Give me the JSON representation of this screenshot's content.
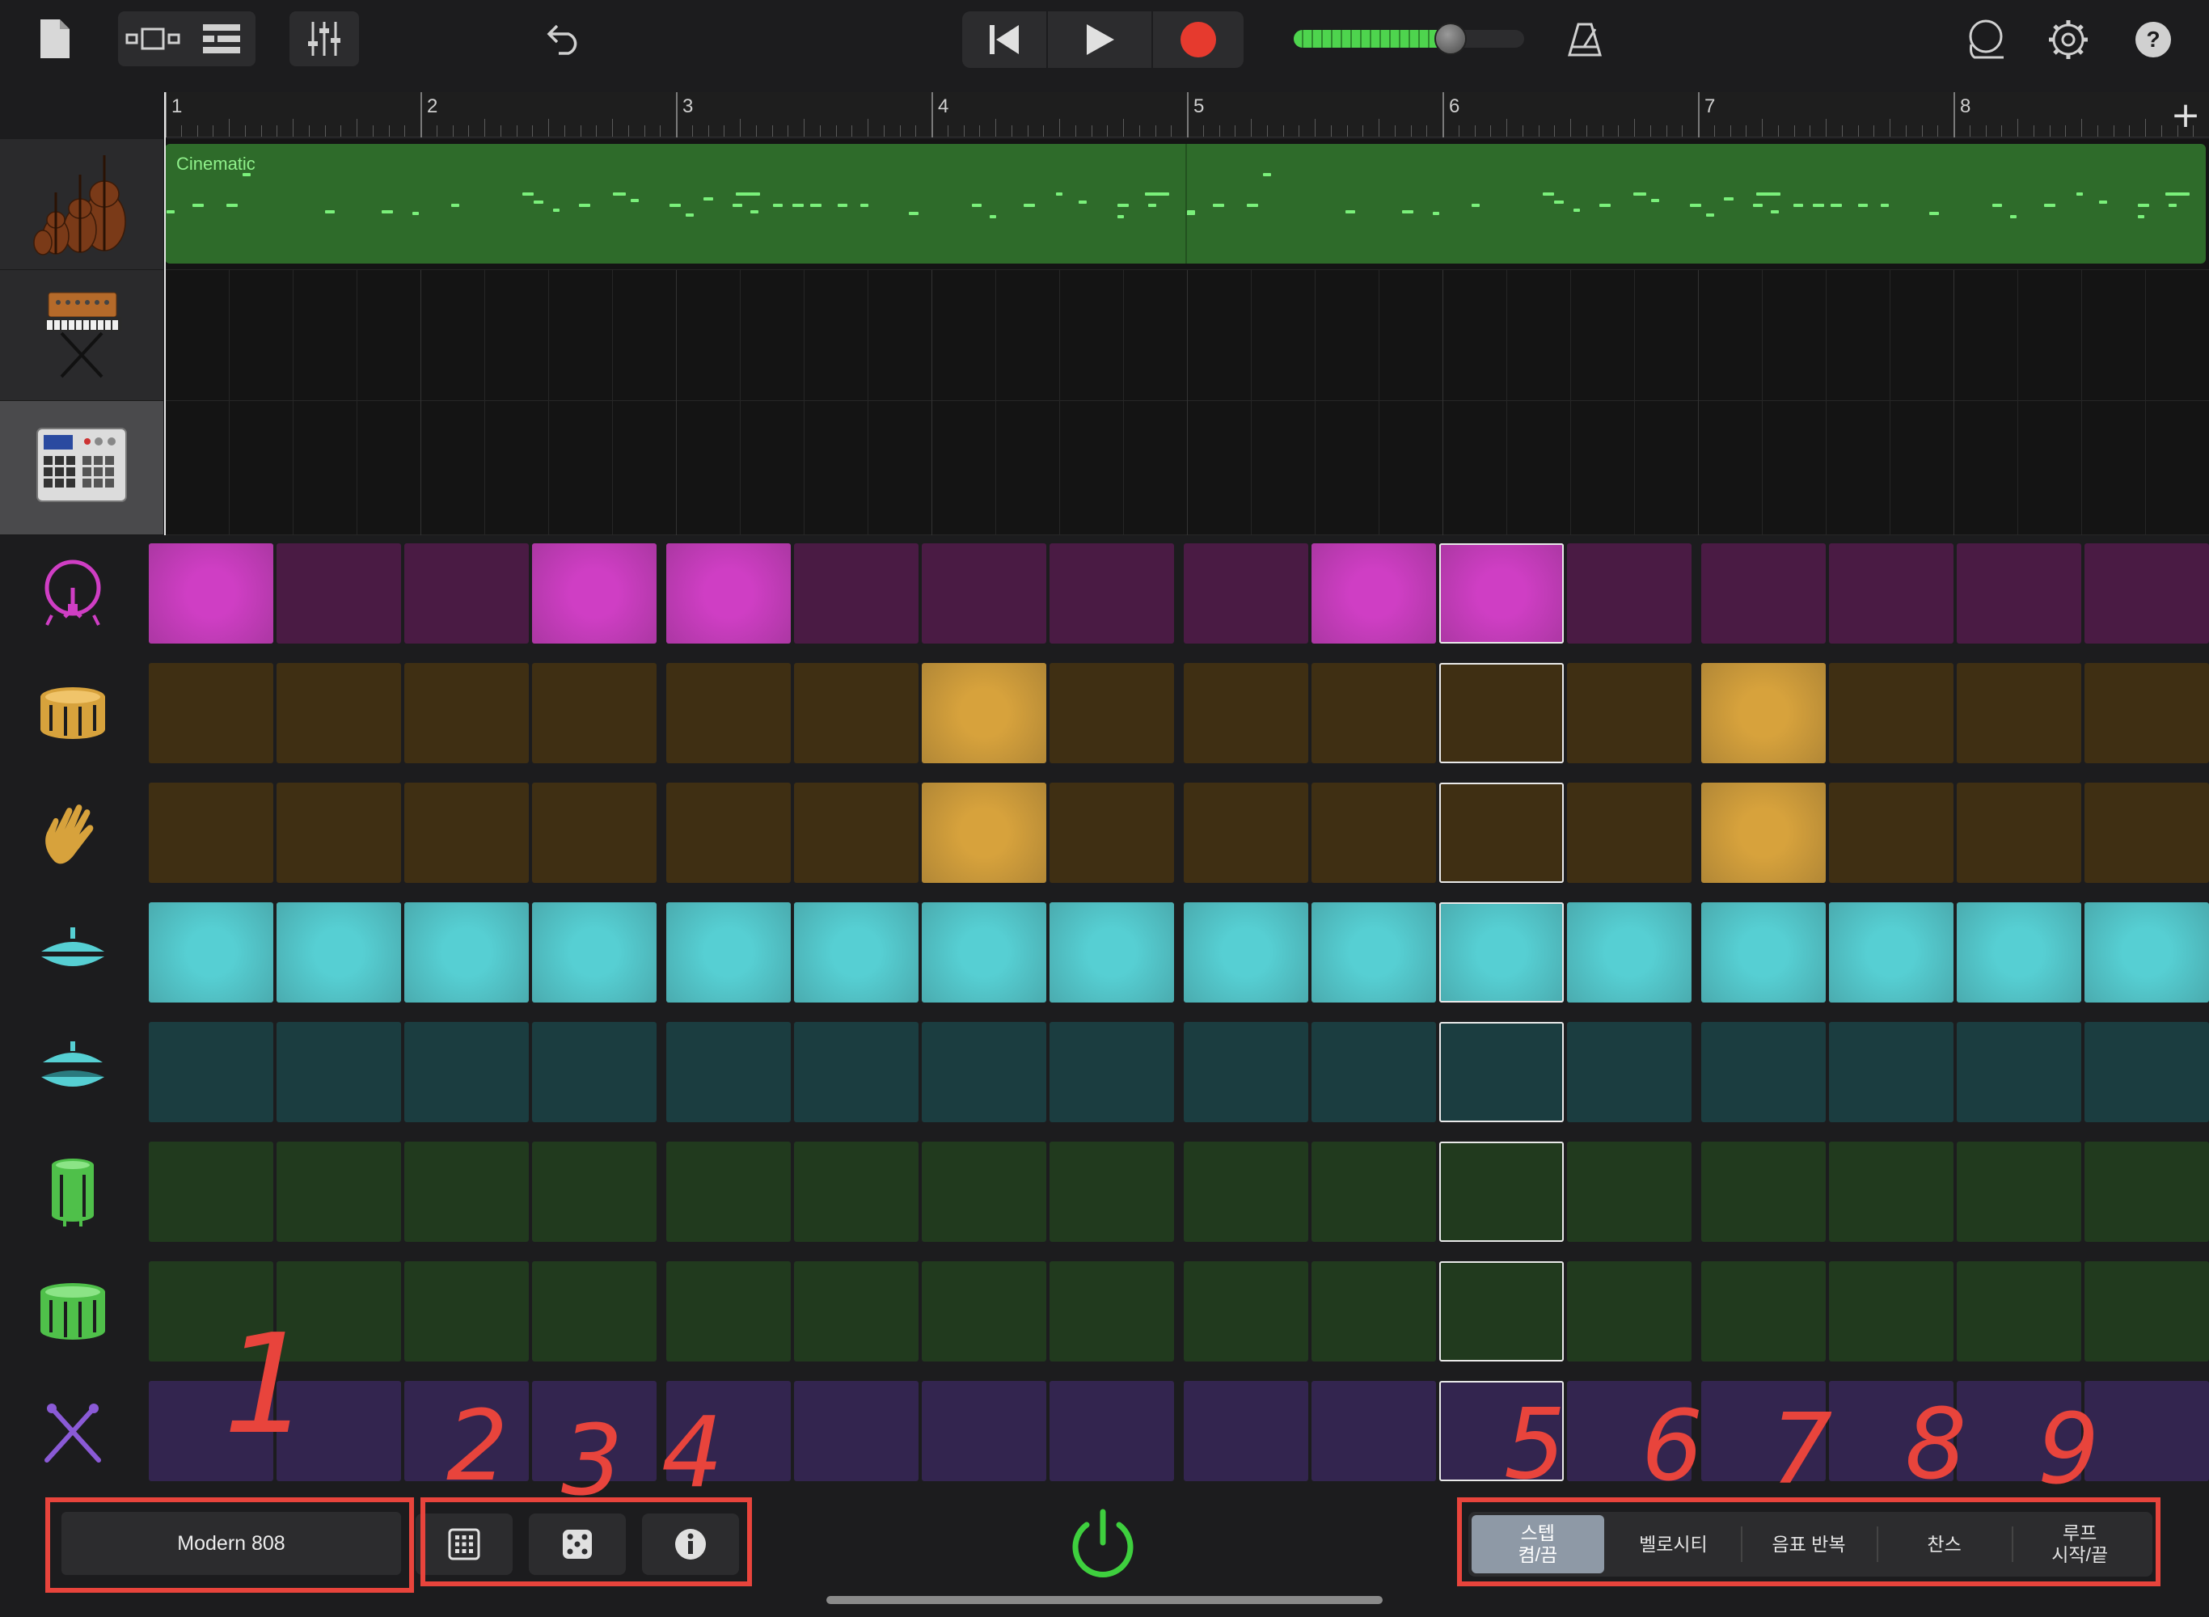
{
  "toolbar": {
    "document_icon": "document-icon",
    "view_icons": [
      "tracks-view-icon",
      "list-view-icon"
    ],
    "mixer_icon": "mixer-sliders-icon",
    "undo_icon": "undo-icon",
    "transport": [
      "rewind-icon",
      "play-icon",
      "record-icon"
    ],
    "master_volume": 0.6,
    "metronome_icon": "metronome-icon",
    "right_icons": [
      "loop-browser-icon",
      "settings-gear-icon",
      "help-icon"
    ],
    "record_color": "#e63a2e",
    "volume_color": "#4ed44e"
  },
  "ruler": {
    "bars": [
      "1",
      "2",
      "3",
      "4",
      "5",
      "6",
      "7",
      "8"
    ],
    "add_label": "+"
  },
  "tracks": [
    {
      "instrument": "strings-ensemble-icon",
      "region_name": "Cinematic",
      "region_color": "#2e6b2a"
    },
    {
      "instrument": "synthesizer-keyboard-icon",
      "region_name": ""
    },
    {
      "instrument": "drum-machine-icon",
      "region_name": "",
      "selected": true
    }
  ],
  "sequencer": {
    "current_step": 11,
    "rows": [
      {
        "name": "kick",
        "icon": "kick-drum-icon",
        "on": "#cf3ec4",
        "off": "#4a1b44",
        "steps": [
          1,
          0,
          0,
          1,
          1,
          0,
          0,
          0,
          0,
          1,
          1,
          0,
          0,
          0,
          0,
          0
        ]
      },
      {
        "name": "snare",
        "icon": "snare-drum-icon",
        "on": "#d7a23c",
        "off": "#3f2f13",
        "steps": [
          0,
          0,
          0,
          0,
          0,
          0,
          1,
          0,
          0,
          0,
          0,
          0,
          1,
          0,
          0,
          0
        ]
      },
      {
        "name": "clap",
        "icon": "hand-clap-icon",
        "on": "#d7a23c",
        "off": "#3f2f13",
        "steps": [
          0,
          0,
          0,
          0,
          0,
          0,
          1,
          0,
          0,
          0,
          0,
          0,
          1,
          0,
          0,
          0
        ]
      },
      {
        "name": "closed-hihat",
        "icon": "closed-hihat-icon",
        "on": "#56cfd3",
        "off": "#1b3d40",
        "steps": [
          1,
          1,
          1,
          1,
          1,
          1,
          1,
          1,
          1,
          1,
          1,
          1,
          1,
          1,
          1,
          1
        ]
      },
      {
        "name": "open-hihat",
        "icon": "open-hihat-icon",
        "on": "#56cfd3",
        "off": "#1b3d40",
        "steps": [
          0,
          0,
          0,
          0,
          0,
          0,
          0,
          0,
          0,
          0,
          0,
          0,
          0,
          0,
          0,
          0
        ]
      },
      {
        "name": "tom-high",
        "icon": "tom-high-icon",
        "on": "#4fc04a",
        "off": "#213a1e",
        "steps": [
          0,
          0,
          0,
          0,
          0,
          0,
          0,
          0,
          0,
          0,
          0,
          0,
          0,
          0,
          0,
          0
        ]
      },
      {
        "name": "tom-low",
        "icon": "tom-low-icon",
        "on": "#4fc04a",
        "off": "#213a1e",
        "steps": [
          0,
          0,
          0,
          0,
          0,
          0,
          0,
          0,
          0,
          0,
          0,
          0,
          0,
          0,
          0,
          0
        ]
      },
      {
        "name": "sticks",
        "icon": "drumsticks-icon",
        "on": "#8a5ad6",
        "off": "#33254f",
        "steps": [
          0,
          0,
          0,
          0,
          0,
          0,
          0,
          0,
          0,
          0,
          0,
          0,
          0,
          0,
          0,
          0
        ]
      }
    ]
  },
  "bottom": {
    "kit_name": "Modern 808",
    "tool_icons": [
      "pattern-grid-icon",
      "randomize-dice-icon",
      "info-icon"
    ],
    "power_icon": "power-icon",
    "power_color": "#3ecf3e",
    "modes": [
      {
        "label": "스텝\n켬/끔",
        "active": true
      },
      {
        "label": "벨로시티",
        "active": false
      },
      {
        "label": "음표 반복",
        "active": false
      },
      {
        "label": "찬스",
        "active": false
      },
      {
        "label": "루프\n시작/끝",
        "active": false
      }
    ]
  },
  "annotations": {
    "color": "#e8443c",
    "numbers": [
      "1",
      "2",
      "3",
      "4",
      "5",
      "6",
      "7",
      "8",
      "9"
    ]
  }
}
